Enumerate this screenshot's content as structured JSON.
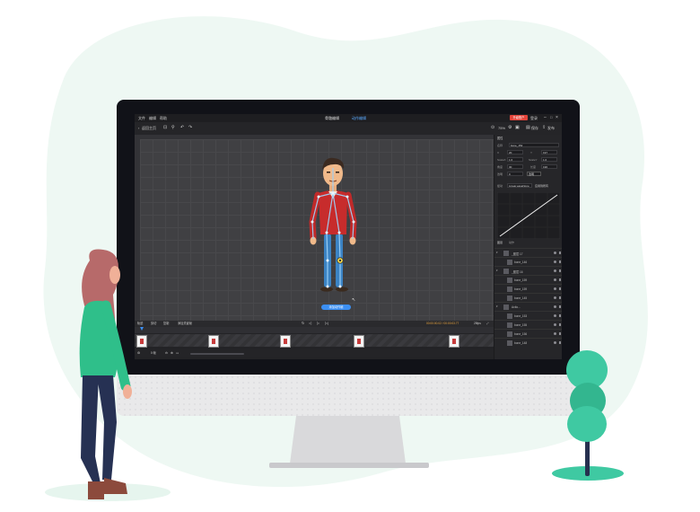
{
  "app": {
    "menu": [
      "文件",
      "编辑",
      "帮助"
    ],
    "mode_tabs": [
      "骨骼编辑",
      "动作编辑"
    ],
    "upgrade_label": "升级账户",
    "login_label": "登录",
    "back_label": "返回主页",
    "zoom_label": "75%",
    "save_label": "保存",
    "publish_label": "发布"
  },
  "canvas": {
    "add_motion_label": "添加动作帧"
  },
  "right_panel": {
    "header": "属性",
    "name_label": "名称",
    "name_value": "bone_152",
    "props": [
      {
        "label": "X",
        "value": "20"
      },
      {
        "label": "Y",
        "value": "197"
      },
      {
        "label": "ScaleX",
        "value": "1.0"
      },
      {
        "label": "ScaleY",
        "value": "1.0"
      },
      {
        "label": "角度",
        "value": "30"
      },
      {
        "label": "长度",
        "value": "196"
      },
      {
        "label": "透明",
        "value": "0"
      },
      {
        "label": "",
        "value": "透明"
      }
    ],
    "easing_label": "缓动",
    "easing_value": "Linear.easeNone",
    "apply_all_label": "应用到所有",
    "layers_header": "图层",
    "layers_sub": "动作",
    "layers": [
      {
        "name": "_图层 17",
        "group": true
      },
      {
        "name": "bone_146",
        "group": false
      },
      {
        "name": "_图层 16",
        "group": true
      },
      {
        "name": "bone_159",
        "group": false
      },
      {
        "name": "bone_159",
        "group": false
      },
      {
        "name": "bone_145",
        "group": false
      },
      {
        "name": "Actio...",
        "group": true
      },
      {
        "name": "bone_153",
        "group": false
      },
      {
        "name": "bone_155",
        "group": false
      },
      {
        "name": "bone_156",
        "group": false
      },
      {
        "name": "bone_148",
        "group": false
      }
    ]
  },
  "timeline": {
    "controls": [
      "轨迹",
      "剪切",
      "复制",
      "添加关键帧"
    ],
    "time_readout": "00:00:00.02 / 00:00:03.77",
    "fps_label": "25fps",
    "frame_count": "0 帧"
  },
  "colors": {
    "blob": "#eef8f3",
    "accent_blue": "#3b8ff3",
    "accent_red": "#e3443a",
    "tree": "#3fc9a2",
    "shirt": "#2fbf8a"
  }
}
